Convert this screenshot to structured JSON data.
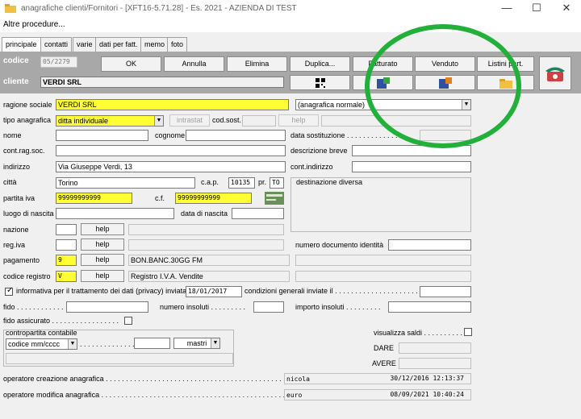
{
  "window": {
    "title": "anagrafiche clienti/Fornitori - [XFT16-5.71.28] - Es. 2021 - AZIENDA DI TEST"
  },
  "menu": {
    "item": "Altre procedure..."
  },
  "tabs": [
    "principale",
    "contatti",
    "varie",
    "dati per fatt.",
    "memo",
    "foto"
  ],
  "header": {
    "codice_label": "codice",
    "codice_value": "05/2279",
    "cliente_label": "cliente",
    "cliente_value": "VERDI SRL",
    "buttons": {
      "ok": "OK",
      "annulla": "Annulla",
      "elimina": "Elimina",
      "duplica": "Duplica...",
      "fatturato": "Fatturato",
      "venduto": "Venduto",
      "listini": "Listini part."
    }
  },
  "form": {
    "ragione_sociale_label": "ragione sociale",
    "ragione_sociale": "VERDI SRL",
    "anagrafica_tipo": "(anagrafica normale)",
    "tipo_anagrafica_label": "tipo anagrafica",
    "tipo_anagrafica": "ditta individuale",
    "intrastat": "intrastat",
    "cod_sost_label": "cod.sost.",
    "help": "help",
    "nome_label": "nome",
    "cognome_label": "cognome",
    "data_sostituzione_label": "data sostituzione . . . . . . . . . . . . . . . .",
    "cont_rag_soc_label": "cont.rag.soc.",
    "descrizione_breve_label": "descrizione breve",
    "indirizzo_label": "indirizzo",
    "indirizzo": "Via Giuseppe Verdi, 13",
    "cont_indirizzo_label": "cont.indirizzo",
    "citta_label": "città",
    "citta": "Torino",
    "cap_label": "c.a.p.",
    "cap": "10135",
    "pr_label": "pr.",
    "pr": "TO",
    "destinazione_label": "destinazione diversa",
    "partita_iva_label": "partita iva",
    "partita_iva": "99999999999",
    "cf_label": "c.f.",
    "cf": "99999999999",
    "luogo_nascita_label": "luogo di nascita",
    "data_nascita_label": "data di nascita",
    "nazione_label": "nazione",
    "reg_iva_label": "reg.iva",
    "numero_documento_label": "numero documento identità",
    "pagamento_label": "pagamento",
    "pagamento_code": "9",
    "pagamento_desc": "BON.BANC.30GG FM",
    "codice_registro_label": "codice registro",
    "codice_registro_code": "V",
    "codice_registro_desc": "Registro I.V.A. Vendite",
    "privacy_label": "informativa per il trattamento dei dati (privacy) inviata il",
    "privacy_date": "18/01/2017",
    "condizioni_label": "condizioni generali inviate il . . . . . . . . . . . . . . . . . . . . . . .",
    "fido_label": "fido . . . . . . . . . . . .",
    "numero_insoluti_label": "numero insoluti . . . . . . . . .",
    "importo_insoluti_label": "importo insoluti . . . . . . . . .",
    "fido_assicurato_label": "fido assicurato . . . . . . . . . . . . . . . . .",
    "contropartita_label": "contropartita contabile",
    "codice_select": "codice mm/cccc",
    "dots": ". . . . . . . . . . . . . .",
    "mastri": "mastri",
    "visualizza_saldi_label": "visualizza saldi . . . . . . . . . .",
    "dare_label": "DARE",
    "avere_label": "AVERE",
    "operatore_creazione_label": "operatore creazione anagrafica . . . . . . . . . . . . . . . . . . . . . . . . . . . . . . . . . . . . . . . . . . . . .",
    "operatore_creazione": "nicola",
    "creazione_ts": "30/12/2016 12:13:37",
    "operatore_modifica_label": "operatore modifica anagrafica . . . . . . . . . . . . . . . . . . . . . . . . . . . . . . . . . . . . . . . . . . . . . .",
    "operatore_modifica": "euro",
    "modifica_ts": "08/09/2021 10:40:24"
  },
  "colors": {
    "highlight": "#ffff33",
    "band": "#a8a8a8",
    "annotation": "#22b03a"
  }
}
